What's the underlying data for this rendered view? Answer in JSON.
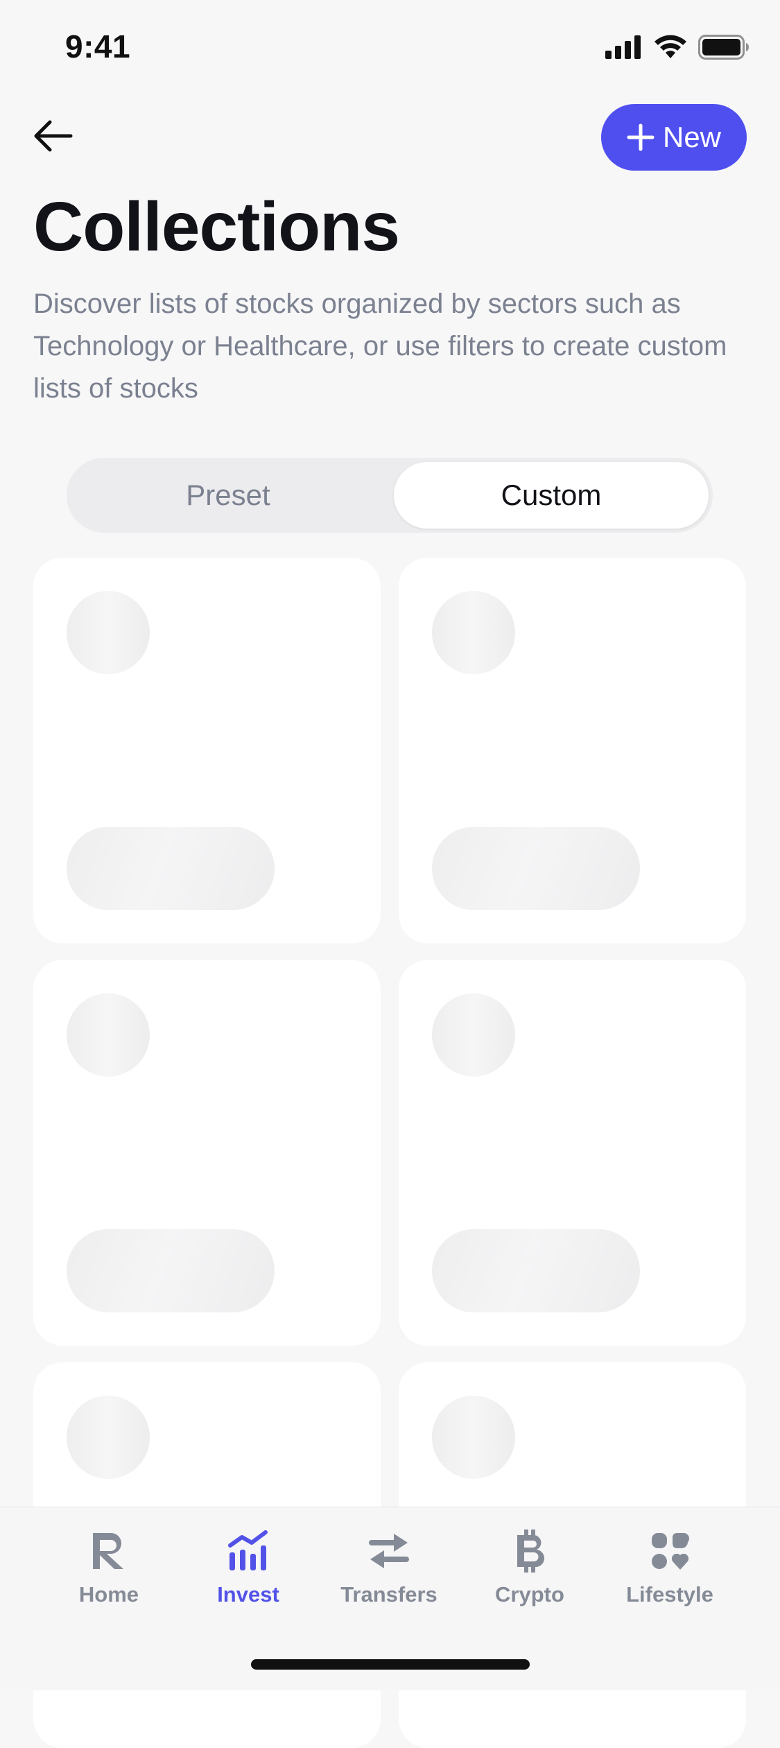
{
  "status_bar": {
    "time": "9:41"
  },
  "header": {
    "back_icon": "arrow-left-icon",
    "new_button_label": "New",
    "title": "Collections",
    "description": "Discover lists of stocks organized by sectors such as Technology or Healthcare, or use filters to create custom lists of stocks"
  },
  "segmented_control": {
    "options": [
      "Preset",
      "Custom"
    ],
    "selected": "Custom"
  },
  "collections": {
    "loading": true,
    "placeholder_cards": 6
  },
  "tab_bar": {
    "active": "Invest",
    "items": [
      {
        "label": "Home",
        "icon": "revolut-r-icon"
      },
      {
        "label": "Invest",
        "icon": "chart-bars-icon"
      },
      {
        "label": "Transfers",
        "icon": "arrows-swap-icon"
      },
      {
        "label": "Crypto",
        "icon": "bitcoin-icon"
      },
      {
        "label": "Lifestyle",
        "icon": "lifestyle-icon"
      }
    ]
  },
  "colors": {
    "accent": "#4f4ff0",
    "background": "#f7f7f8",
    "text_primary": "#111318",
    "text_secondary": "#7b8190",
    "tab_inactive": "#858b96"
  }
}
